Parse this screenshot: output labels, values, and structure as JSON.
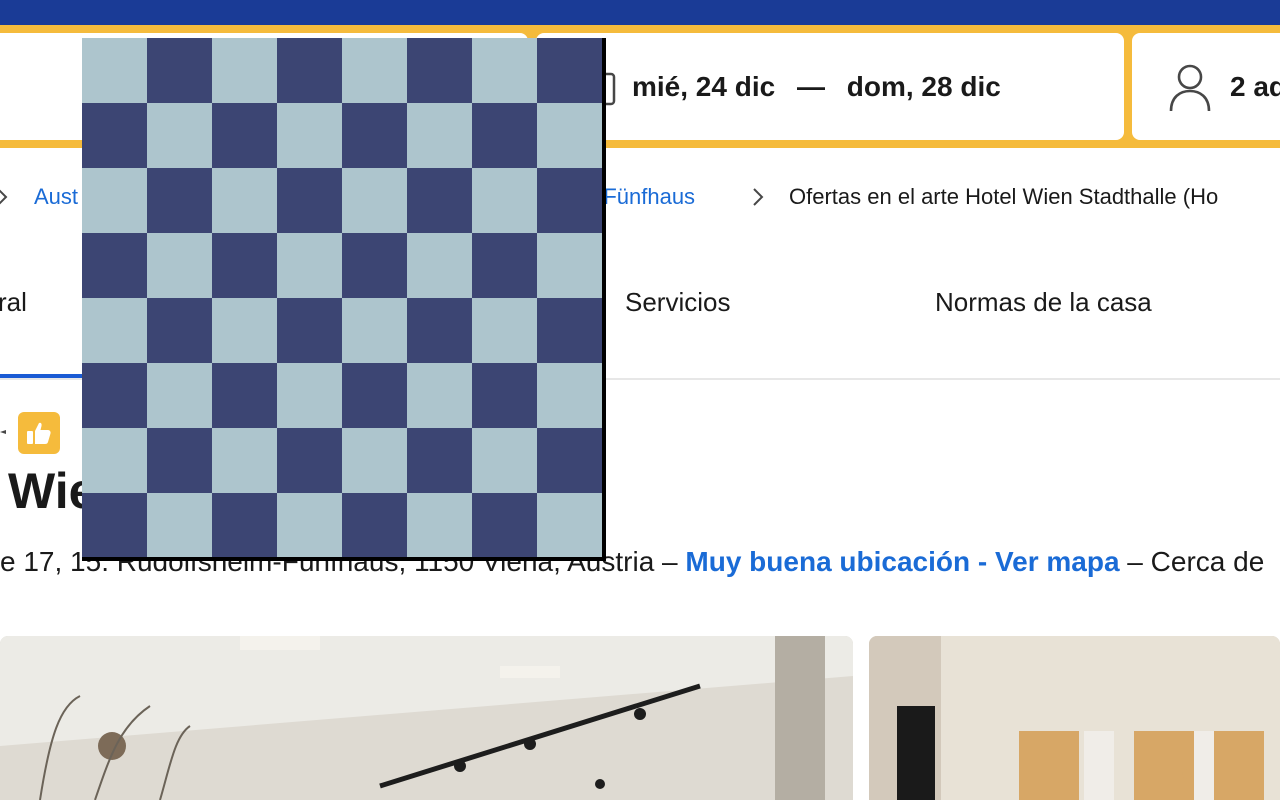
{
  "search": {
    "dates": {
      "checkin": "mié, 24 dic",
      "separator": "—",
      "checkout": "dom, 28 dic"
    },
    "guests": "2 ad"
  },
  "breadcrumb": {
    "items": [
      "Aust",
      "-Fünfhaus"
    ],
    "current": "Ofertas en el arte Hotel Wien Stadthalle (Ho"
  },
  "tabs": {
    "items": [
      "ral",
      "Servicios",
      "Normas de la casa"
    ]
  },
  "hotel": {
    "title_fragment": "Wie",
    "address": {
      "text": "e 17, 15. Rudolfsheim-Fünfhaus, 1150 Viena, Austria – ",
      "location_link": "Muy buena ubicación - Ver mapa",
      "suffix": " – Cerca de"
    }
  },
  "colors": {
    "brand_blue": "#1a3b96",
    "search_yellow": "#f5bb3c",
    "link_blue": "#1a6bd6",
    "checker_dark": "#3c4573",
    "checker_light": "#adc5cd"
  },
  "icons": {
    "calendar": "calendar-icon",
    "person": "person-icon",
    "chevron": "chevron-right-icon",
    "thumbs_up": "thumbs-up-icon"
  }
}
